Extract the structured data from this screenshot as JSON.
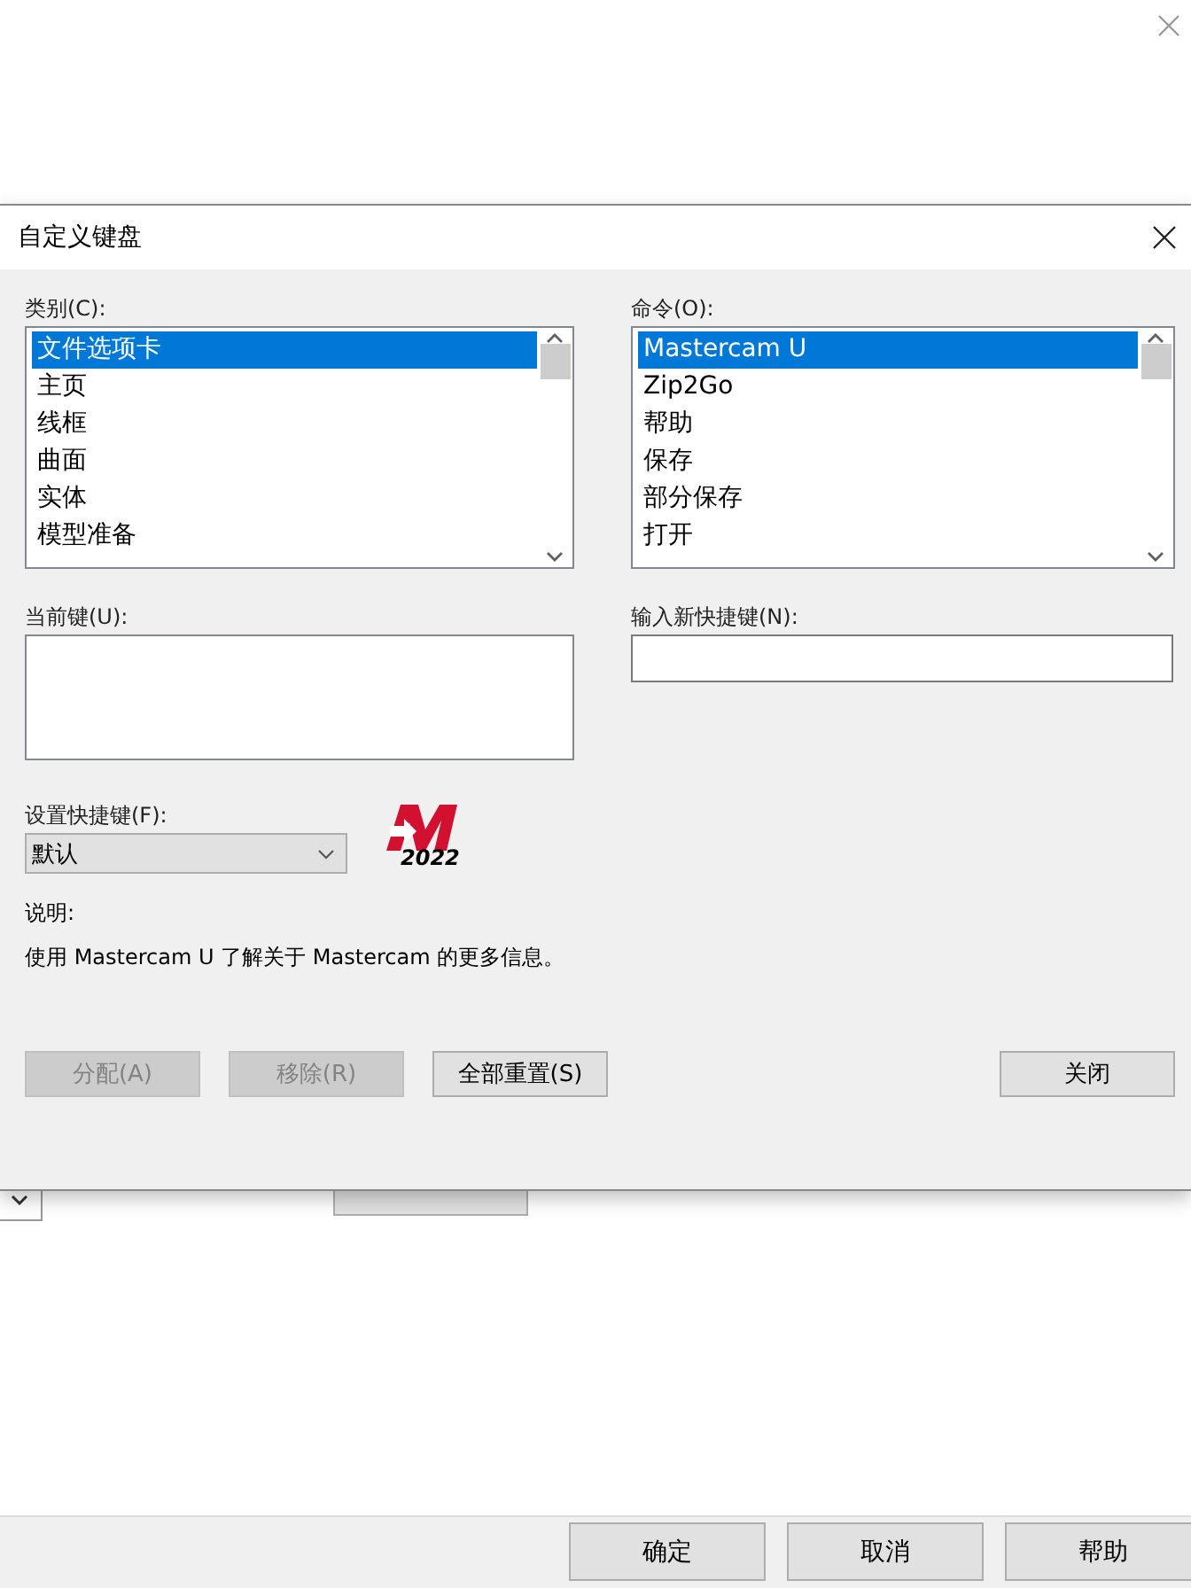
{
  "background": {
    "buttons": [
      {
        "label": "确定"
      },
      {
        "label": "取消"
      },
      {
        "label": "帮助"
      }
    ]
  },
  "dialog": {
    "title": "自定义键盘",
    "category": {
      "label": "类别(C):",
      "items": [
        {
          "label": "文件选项卡",
          "selected": true
        },
        {
          "label": "主页",
          "selected": false
        },
        {
          "label": "线框",
          "selected": false
        },
        {
          "label": "曲面",
          "selected": false
        },
        {
          "label": "实体",
          "selected": false
        },
        {
          "label": "模型准备",
          "selected": false
        }
      ]
    },
    "command": {
      "label": "命令(O):",
      "items": [
        {
          "label": "Mastercam U",
          "selected": true
        },
        {
          "label": "Zip2Go",
          "selected": false
        },
        {
          "label": "帮助",
          "selected": false
        },
        {
          "label": "保存",
          "selected": false
        },
        {
          "label": "部分保存",
          "selected": false
        },
        {
          "label": "打开",
          "selected": false
        }
      ]
    },
    "current_keys": {
      "label": "当前键(U):"
    },
    "new_shortcut": {
      "label": "输入新快捷键(N):"
    },
    "shortcut_set": {
      "label": "设置快捷键(F):",
      "value": "默认"
    },
    "logo": {
      "caption": "2022"
    },
    "description": {
      "label": "说明:",
      "text": "使用 Mastercam U 了解关于 Mastercam 的更多信息。"
    },
    "buttons": [
      {
        "label": "分配(A)",
        "disabled": true
      },
      {
        "label": "移除(R)",
        "disabled": true
      },
      {
        "label": "全部重置(S)",
        "disabled": false
      }
    ],
    "close_button": {
      "label": "关闭"
    }
  }
}
